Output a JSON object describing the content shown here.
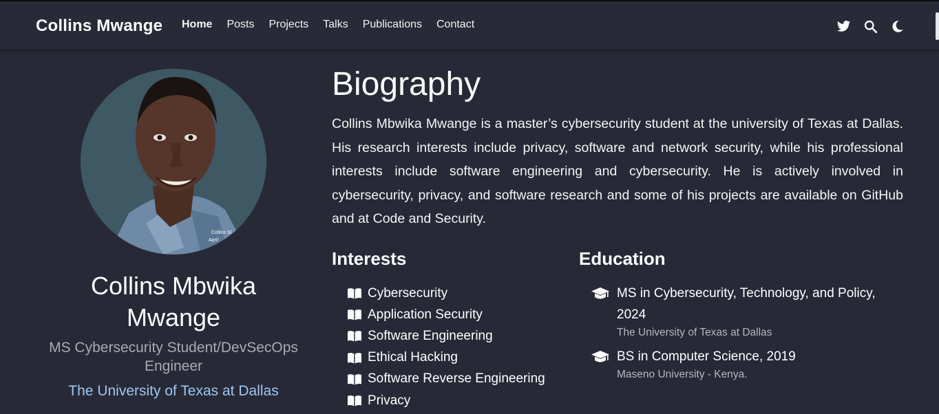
{
  "navbar": {
    "brand": "Collins Mwange",
    "links": [
      {
        "label": "Home",
        "active": true
      },
      {
        "label": "Posts"
      },
      {
        "label": "Projects"
      },
      {
        "label": "Talks"
      },
      {
        "label": "Publications"
      },
      {
        "label": "Contact"
      }
    ],
    "icons": [
      "twitter-icon",
      "search-icon",
      "moon-icon"
    ]
  },
  "profile": {
    "name": "Collins Mbwika Mwange",
    "role": "MS Cybersecurity Student/DevSecOps Engineer",
    "organization": "The University of Texas at Dallas",
    "photo_caption": "Collins Sl... April..."
  },
  "biography": {
    "title": "Biography",
    "text": "Collins Mbwika Mwange is a master’s cybersecurity student at the university of Texas at Dallas. His research interests include privacy, software and network security, while his professional interests include software engineering and cybersecurity. He is actively involved in cybersecurity, privacy, and software research and some of his projects are available on GitHub and at Code and Security."
  },
  "interests": {
    "title": "Interests",
    "items": [
      "Cybersecurity",
      "Application Security",
      "Software Engineering",
      "Ethical Hacking",
      "Software Reverse Engineering",
      "Privacy"
    ]
  },
  "education": {
    "title": "Education",
    "items": [
      {
        "degree": "MS in Cybersecurity, Technology, and Policy, 2024",
        "school": "The University of Texas at Dallas"
      },
      {
        "degree": "BS in Computer Science, 2019",
        "school": "Maseno University - Kenya."
      }
    ]
  },
  "colors": {
    "background": "#272a36",
    "accent_link": "#9fc6f4",
    "muted_text": "#a9abb3"
  }
}
